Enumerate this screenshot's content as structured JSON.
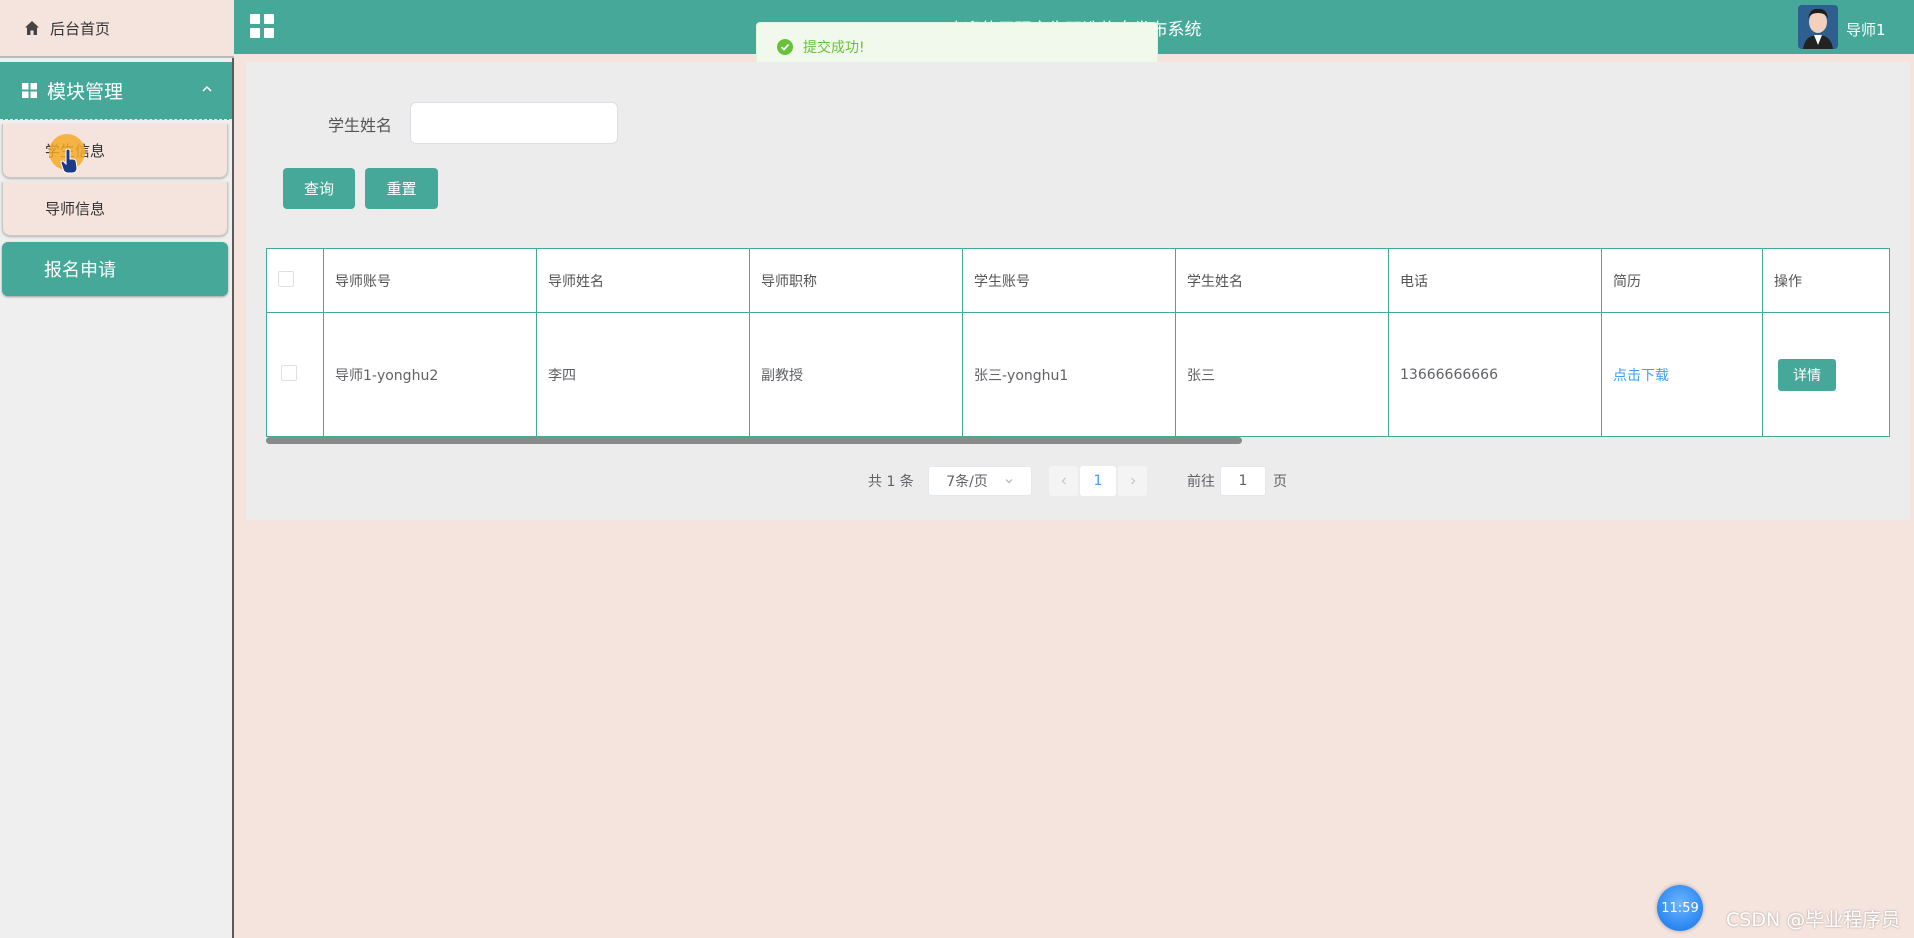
{
  "sidebar": {
    "home_label": "后台首页",
    "module_label": "模块管理",
    "items": [
      {
        "label": "学生信息"
      },
      {
        "label": "导师信息"
      }
    ],
    "apply_label": "报名申请"
  },
  "header": {
    "title": "欢迎使用研究生双选信息发布系统",
    "username": "导师1"
  },
  "toast": {
    "message": "提交成功!"
  },
  "search": {
    "label": "学生姓名",
    "value": "",
    "query_button": "查询",
    "reset_button": "重置"
  },
  "table": {
    "columns": [
      "导师账号",
      "导师姓名",
      "导师职称",
      "学生账号",
      "学生姓名",
      "电话",
      "简历",
      "操作"
    ],
    "rows": [
      {
        "tutor_account": "导师1-yonghu2",
        "tutor_name": "李四",
        "tutor_title": "副教授",
        "student_account": "张三-yonghu1",
        "student_name": "张三",
        "phone": "13666666666",
        "resume_link": "点击下载",
        "action": "详情"
      }
    ]
  },
  "pagination": {
    "total_text": "共 1 条",
    "page_size": "7条/页",
    "current_page": "1",
    "goto_prefix": "前往",
    "goto_value": "1",
    "goto_suffix": "页"
  },
  "overlay": {
    "clock": "11:59",
    "watermark": "CSDN @毕业程序员"
  },
  "colors": {
    "accent": "#46a898",
    "background": "#f5e3dd",
    "link": "#409eff",
    "success": "#67c23a"
  },
  "icons": [
    "home-icon",
    "grid-icon",
    "chevron-up-icon",
    "menu-grid-icon",
    "success-check-icon",
    "chevron-down-icon",
    "chevron-left-icon",
    "chevron-right-icon"
  ]
}
